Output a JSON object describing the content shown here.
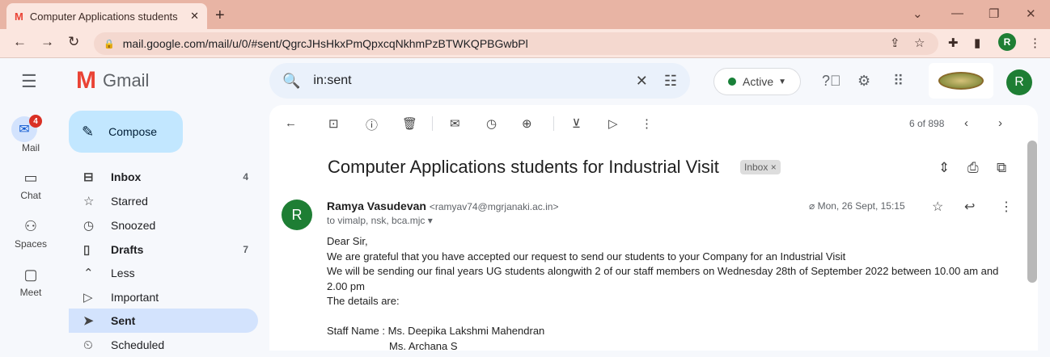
{
  "browser": {
    "tab_title": "Computer Applications students",
    "url": "mail.google.com/mail/u/0/#sent/QgrcJHsHkxPmQpxcqNkhmPzBTWKQPBGwbPl",
    "profile_initial": "R"
  },
  "gmail": {
    "logo_text": "Gmail",
    "search_query": "in:sent",
    "status_label": "Active",
    "avatar_initial": "R"
  },
  "rail": {
    "mail_badge": "4",
    "items": [
      {
        "label": "Mail",
        "icon": "mail-icon"
      },
      {
        "label": "Chat",
        "icon": "chat-icon"
      },
      {
        "label": "Spaces",
        "icon": "spaces-icon"
      },
      {
        "label": "Meet",
        "icon": "meet-icon"
      }
    ]
  },
  "sidebar": {
    "compose_label": "Compose",
    "items": [
      {
        "label": "Inbox",
        "count": "4",
        "icon": "inbox-icon",
        "bold": true
      },
      {
        "label": "Starred",
        "count": "",
        "icon": "star-icon"
      },
      {
        "label": "Snoozed",
        "count": "",
        "icon": "clock-icon"
      },
      {
        "label": "Drafts",
        "count": "7",
        "icon": "draft-icon",
        "bold": true
      },
      {
        "label": "Less",
        "count": "",
        "icon": "chevron-up-icon"
      },
      {
        "label": "Important",
        "count": "",
        "icon": "important-icon"
      },
      {
        "label": "Sent",
        "count": "",
        "icon": "send-icon",
        "bold": true,
        "selected": true
      },
      {
        "label": "Scheduled",
        "count": "",
        "icon": "scheduled-icon"
      }
    ]
  },
  "toolbar": {
    "pagination": "6 of 898"
  },
  "message": {
    "subject": "Computer Applications students for Industrial Visit",
    "label_chip": "Inbox",
    "sender_name": "Ramya Vasudevan",
    "sender_email": "<ramyav74@mgrjanaki.ac.in>",
    "sender_initial": "R",
    "recipients": "to vimalp, nsk, bca.mjc",
    "date": "Mon, 26 Sept, 15:15",
    "body_lines": [
      "Dear Sir,",
      "We are grateful that you have accepted our request to send our students to your Company for an Industrial Visit",
      "We will be sending our final years UG students alongwith 2 of our staff members on Wednesday 28th of September 2022 between 10.00 am and",
      "2.00 pm",
      "The details are:",
      "",
      "Staff Name : Ms. Deepika Lakshmi Mahendran",
      "Ms. Archana S"
    ]
  },
  "colors": {
    "tabstrip": "#e8b4a4",
    "accent": "#0b57d0",
    "selected_nav": "#d3e3fd",
    "compose": "#c2e7ff"
  }
}
